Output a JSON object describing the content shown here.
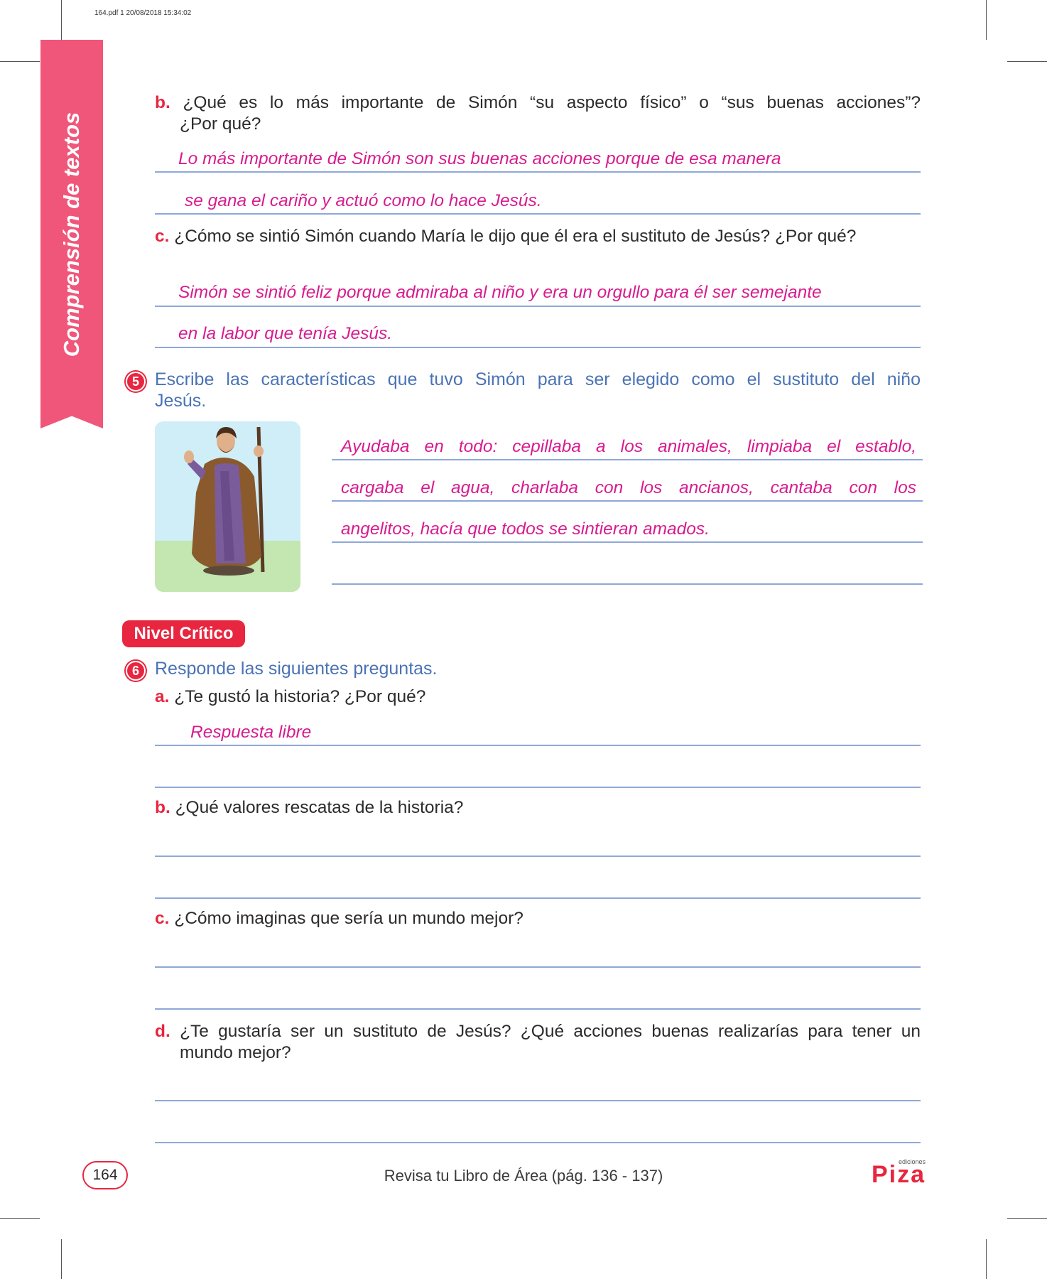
{
  "print_info": "164.pdf   1   20/08/2018   15:34:02",
  "side_tab": {
    "title": "Comprensión de textos"
  },
  "q4": {
    "b": {
      "letter": "b.",
      "line1": "¿Qué es lo más importante de Simón “su aspecto físico” o “sus buenas acciones”?",
      "line2": "¿Por qué?",
      "answer1": "Lo más importante de Simón son sus buenas acciones porque de esa manera",
      "answer2": "se gana el cariño y actuó como lo hace Jesús."
    },
    "c": {
      "letter": "c.",
      "text": "¿Cómo se sintió Simón cuando María le dijo que él era el sustituto de Jesús? ¿Por qué?",
      "answer1": "Simón se sintió feliz porque admiraba al niño y era un orgullo para él ser semejante",
      "answer2": "en la labor que tenía Jesús."
    }
  },
  "q5": {
    "number": "5",
    "line1": "Escribe las características que tuvo Simón para ser elegido como el sustituto del niño",
    "line2": "Jesús.",
    "answer1": "Ayudaba en todo: cepillaba a los animales, limpiaba el establo,",
    "answer2": "cargaba el agua, charlaba con los ancianos, cantaba con los",
    "answer3": "angelitos, hacía que todos se sintieran amados."
  },
  "nivel_label": "Nivel Crítico",
  "q6": {
    "number": "6",
    "instruction": "Responde las siguientes preguntas.",
    "a": {
      "letter": "a.",
      "text": "¿Te gustó la historia? ¿Por qué?",
      "answer": "Respuesta libre"
    },
    "b": {
      "letter": "b.",
      "text": "¿Qué valores rescatas de la historia?"
    },
    "c": {
      "letter": "c.",
      "text": "¿Cómo imaginas que sería un mundo mejor?"
    },
    "d": {
      "letter": "d.",
      "line1": "¿Te gustaría ser un sustituto de Jesús? ¿Qué acciones buenas realizarías para tener un",
      "line2": "mundo mejor?"
    }
  },
  "footer": {
    "page_number": "164",
    "text": "Revisa tu Libro de Área (pág. 136 - 137)",
    "logo_small": "ediciones",
    "logo_main": "Piza"
  },
  "colors": {
    "accent_red": "#e8263f",
    "tab_pink": "#f0567a",
    "answer_magenta": "#d81b8f",
    "instruction_blue": "#4a73b5",
    "rule_blue": "#8fa8d8"
  }
}
